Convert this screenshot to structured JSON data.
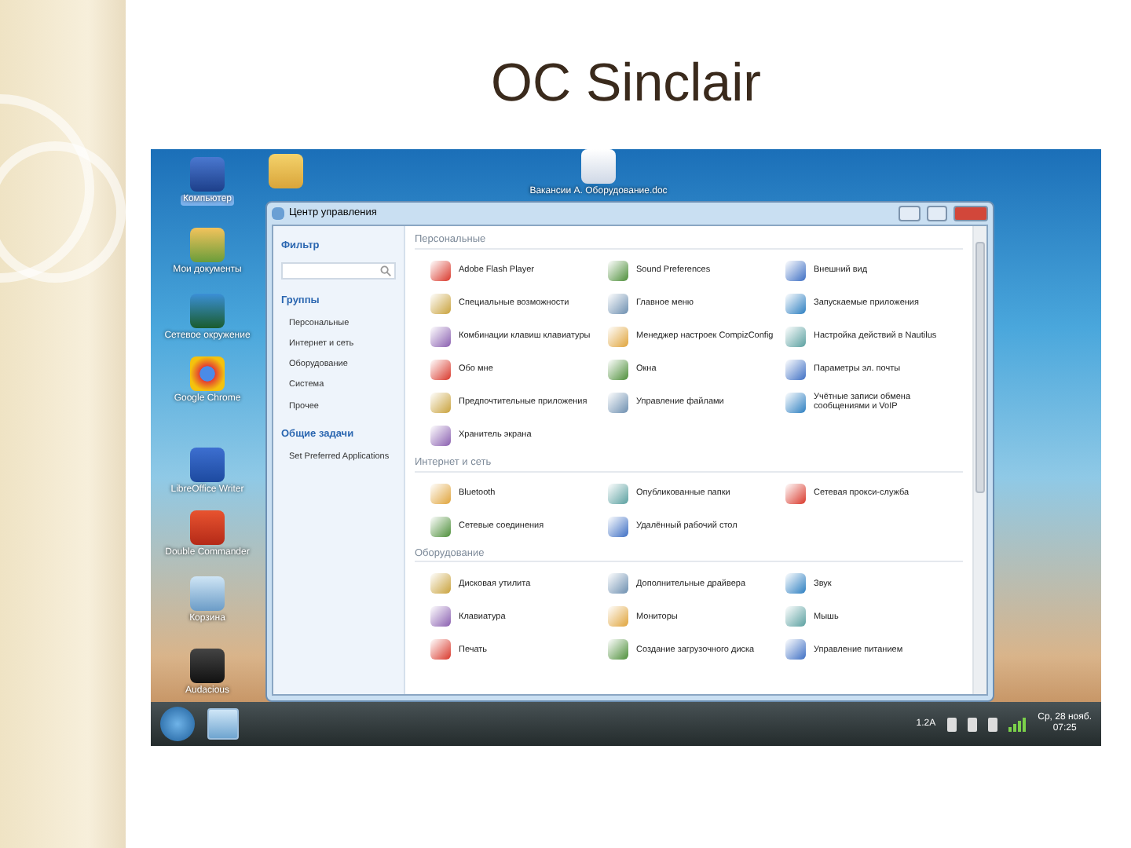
{
  "slide": {
    "title": "ОС Sinclair"
  },
  "desktop": {
    "icons": [
      {
        "label": "Компьютер",
        "selected": true
      },
      {
        "selected": false
      },
      {
        "label": "Мои документы",
        "selected": false
      },
      {
        "label": "Сетевое окружение",
        "selected": false
      },
      {
        "label": "Google Chrome",
        "selected": false
      },
      {
        "label": "LibreOffice Writer",
        "selected": false
      },
      {
        "label": "Double Commander",
        "selected": false
      },
      {
        "label": "Корзина",
        "selected": false
      },
      {
        "label": "Audacious",
        "selected": false
      },
      {
        "label": "Вакансии А. Оборудование.doc",
        "selected": false
      }
    ]
  },
  "window": {
    "title": "Центр управления",
    "sidebar": {
      "filter_heading": "Фильтр",
      "groups_heading": "Группы",
      "groups": [
        "Персональные",
        "Интернет и сеть",
        "Оборудование",
        "Система",
        "Прочее"
      ],
      "tasks_heading": "Общие задачи",
      "tasks": [
        "Set Preferred Applications"
      ]
    },
    "sections": [
      {
        "heading": "Персональные",
        "items": [
          "Adobe Flash Player",
          "Sound Preferences",
          "Внешний вид",
          "Специальные возможности",
          "Главное меню",
          "Запускаемые приложения",
          "Комбинации клавиш клавиатуры",
          "Менеджер настроек CompizConfig",
          "Настройка действий в Nautilus",
          "Обо мне",
          "Окна",
          "Параметры эл. почты",
          "Предпочтительные приложения",
          "Управление файлами",
          "Учётные записи обмена сообщениями и VoIP",
          "Хранитель экрана"
        ]
      },
      {
        "heading": "Интернет и сеть",
        "items": [
          "Bluetooth",
          "Опубликованные папки",
          "Сетевая прокси-служба",
          "Сетевые соединения",
          "Удалённый рабочий стол"
        ]
      },
      {
        "heading": "Оборудование",
        "items": [
          "Дисковая утилита",
          "Дополнительные драйвера",
          "Звук",
          "Клавиатура",
          "Мониторы",
          "Мышь",
          "Печать",
          "Создание загрузочного диска",
          "Управление питанием"
        ]
      }
    ]
  },
  "taskbar": {
    "tray_text": "1.2A",
    "clock_date": "Ср, 28 нояб.",
    "clock_time": "07:25"
  }
}
